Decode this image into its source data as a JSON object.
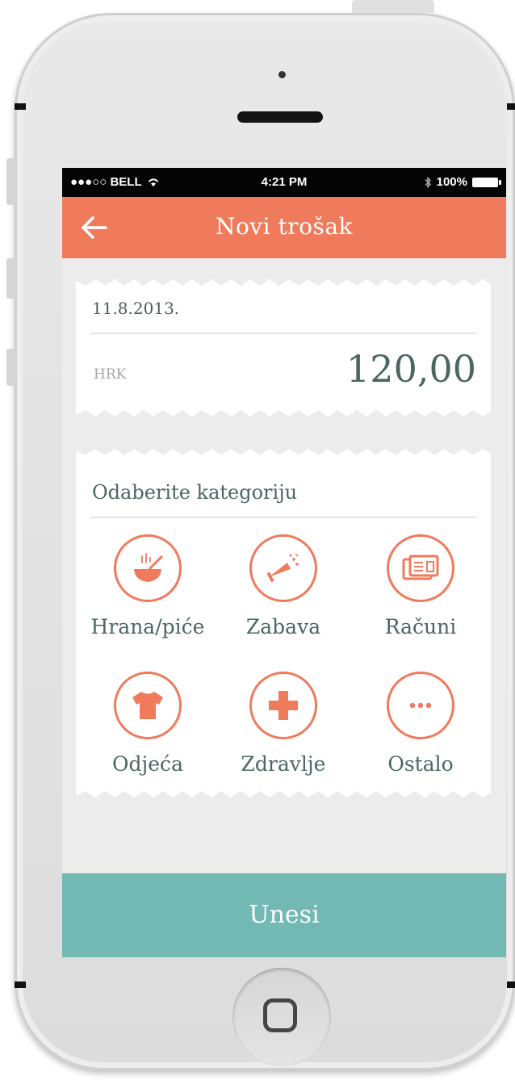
{
  "status_bar": {
    "carrier": "●●●○○ BELL",
    "time": "4:21 PM",
    "battery": "100%"
  },
  "header": {
    "title": "Novi trošak",
    "back_icon": "arrow-left-icon"
  },
  "expense": {
    "date": "11.8.2013.",
    "currency": "HRK",
    "amount": "120,00"
  },
  "category_section": {
    "title": "Odaberite kategoriju",
    "categories": [
      {
        "label": "Hrana/piće",
        "icon": "food-bowl-icon"
      },
      {
        "label": "Zabava",
        "icon": "party-horn-icon"
      },
      {
        "label": "Računi",
        "icon": "bills-icon"
      },
      {
        "label": "Odjeća",
        "icon": "shirt-icon"
      },
      {
        "label": "Zdravlje",
        "icon": "health-cross-icon"
      },
      {
        "label": "Ostalo",
        "icon": "more-dots-icon"
      }
    ]
  },
  "submit": {
    "label": "Unesi"
  },
  "colors": {
    "accent": "#ef7b5c",
    "primary_button": "#72b9b4",
    "text": "#4b6664",
    "screen_background": "#ececec"
  }
}
